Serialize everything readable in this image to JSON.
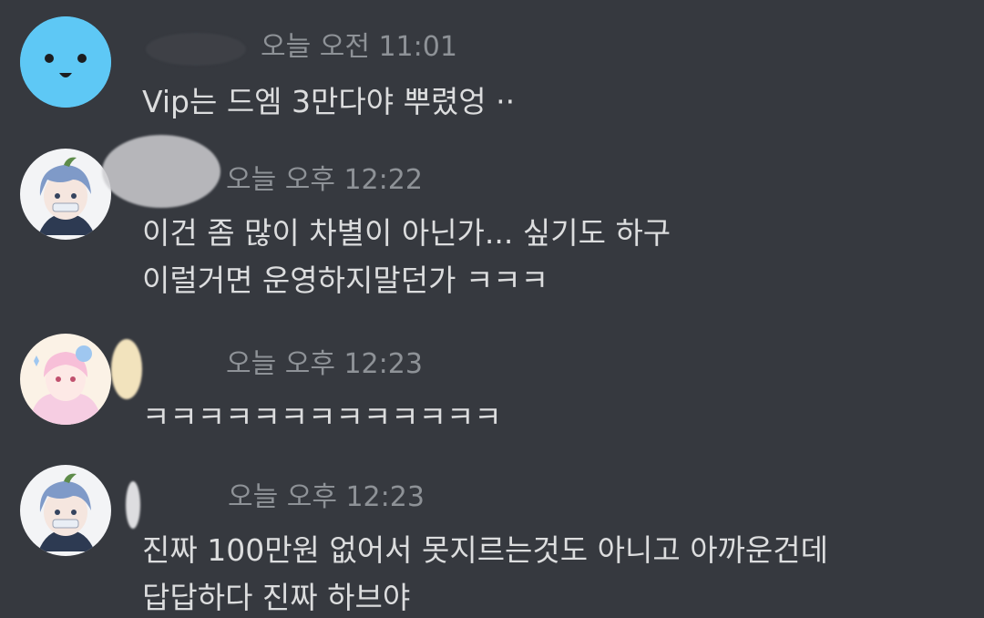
{
  "messages": [
    {
      "avatar": "blue-smiley-avatar",
      "time": "오늘 오전 11:01",
      "lines": [
        "Vip는 드엠 3만다야 뿌렸엉 ··"
      ]
    },
    {
      "avatar": "blue-hair-character-avatar",
      "time": "오늘 오후 12:22",
      "lines": [
        "이건 좀 많이 차별이 아닌가... 싶기도 하구",
        "이럴거면 운영하지말던가 ㅋㅋㅋ"
      ]
    },
    {
      "avatar": "pink-character-avatar",
      "time": "오늘 오후 12:23",
      "lines": [
        "ㅋㅋㅋㅋㅋㅋㅋㅋㅋㅋㅋㅋㅋ"
      ]
    },
    {
      "avatar": "blue-hair-character-avatar",
      "time": "오늘 오후 12:23",
      "lines": [
        "진짜 100만원 없어서 못지르는것도 아니고 아까운건데",
        "답답하다 진짜 하브야"
      ]
    }
  ],
  "colors": {
    "background": "#36393f",
    "timestamp": "#8e9297",
    "message_text": "#dcddde",
    "smiley_avatar_bg": "#5ec8f5"
  }
}
